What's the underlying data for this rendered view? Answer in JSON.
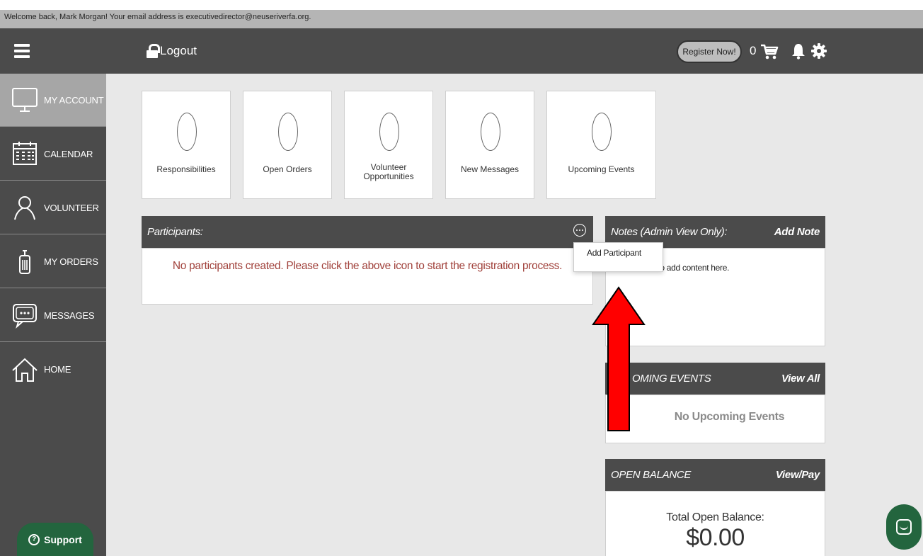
{
  "welcome": {
    "text": "Welcome back, Mark Morgan! Your email address is executivedirector@neuseriverfa.org."
  },
  "topbar": {
    "logout_label": "Logout",
    "register_label": "Register Now!",
    "cart_count": "0",
    "icons": [
      "menu-icon",
      "lock-icon",
      "cart-icon",
      "bell-icon",
      "gear-icon"
    ]
  },
  "sidebar": {
    "items": [
      {
        "label": "MY ACCOUNT",
        "icon": "monitor-icon",
        "active": true
      },
      {
        "label": "CALENDAR",
        "icon": "calendar-icon"
      },
      {
        "label": "VOLUNTEER",
        "icon": "person-icon"
      },
      {
        "label": "MY ORDERS",
        "icon": "receipt-icon"
      },
      {
        "label": "MESSAGES",
        "icon": "chat-bubble-icon"
      },
      {
        "label": "HOME",
        "icon": "house-icon"
      }
    ],
    "support_label": "Support"
  },
  "stats": [
    {
      "value": "0",
      "label": "Responsibilities"
    },
    {
      "value": "0",
      "label": "Open Orders"
    },
    {
      "value": "0",
      "label": "Volunteer\nOpportunities"
    },
    {
      "value": "0",
      "label": "New Messages"
    },
    {
      "value": "0",
      "label": "Upcoming Events"
    }
  ],
  "participants": {
    "title": "Participants:",
    "message": "No participants created. Please click the above icon to start the registration process.",
    "menu_item": "Add Participant"
  },
  "notes": {
    "title": "Notes (Admin View Only):",
    "action": "Add Note",
    "text": "e\" to add content here."
  },
  "upcoming": {
    "title": "OMING EVENTS",
    "action": "View All",
    "empty": "No Upcoming Events"
  },
  "balance": {
    "title": "OPEN BALANCE",
    "action": "View/Pay",
    "label": "Total Open Balance:",
    "amount": "$0.00"
  },
  "colors": {
    "topbar": "#4b4b4b",
    "sidebar_active": "#a6a6a6",
    "message_red": "#a0403a",
    "support_green": "#23653e",
    "arrow_red": "#ff0000"
  }
}
